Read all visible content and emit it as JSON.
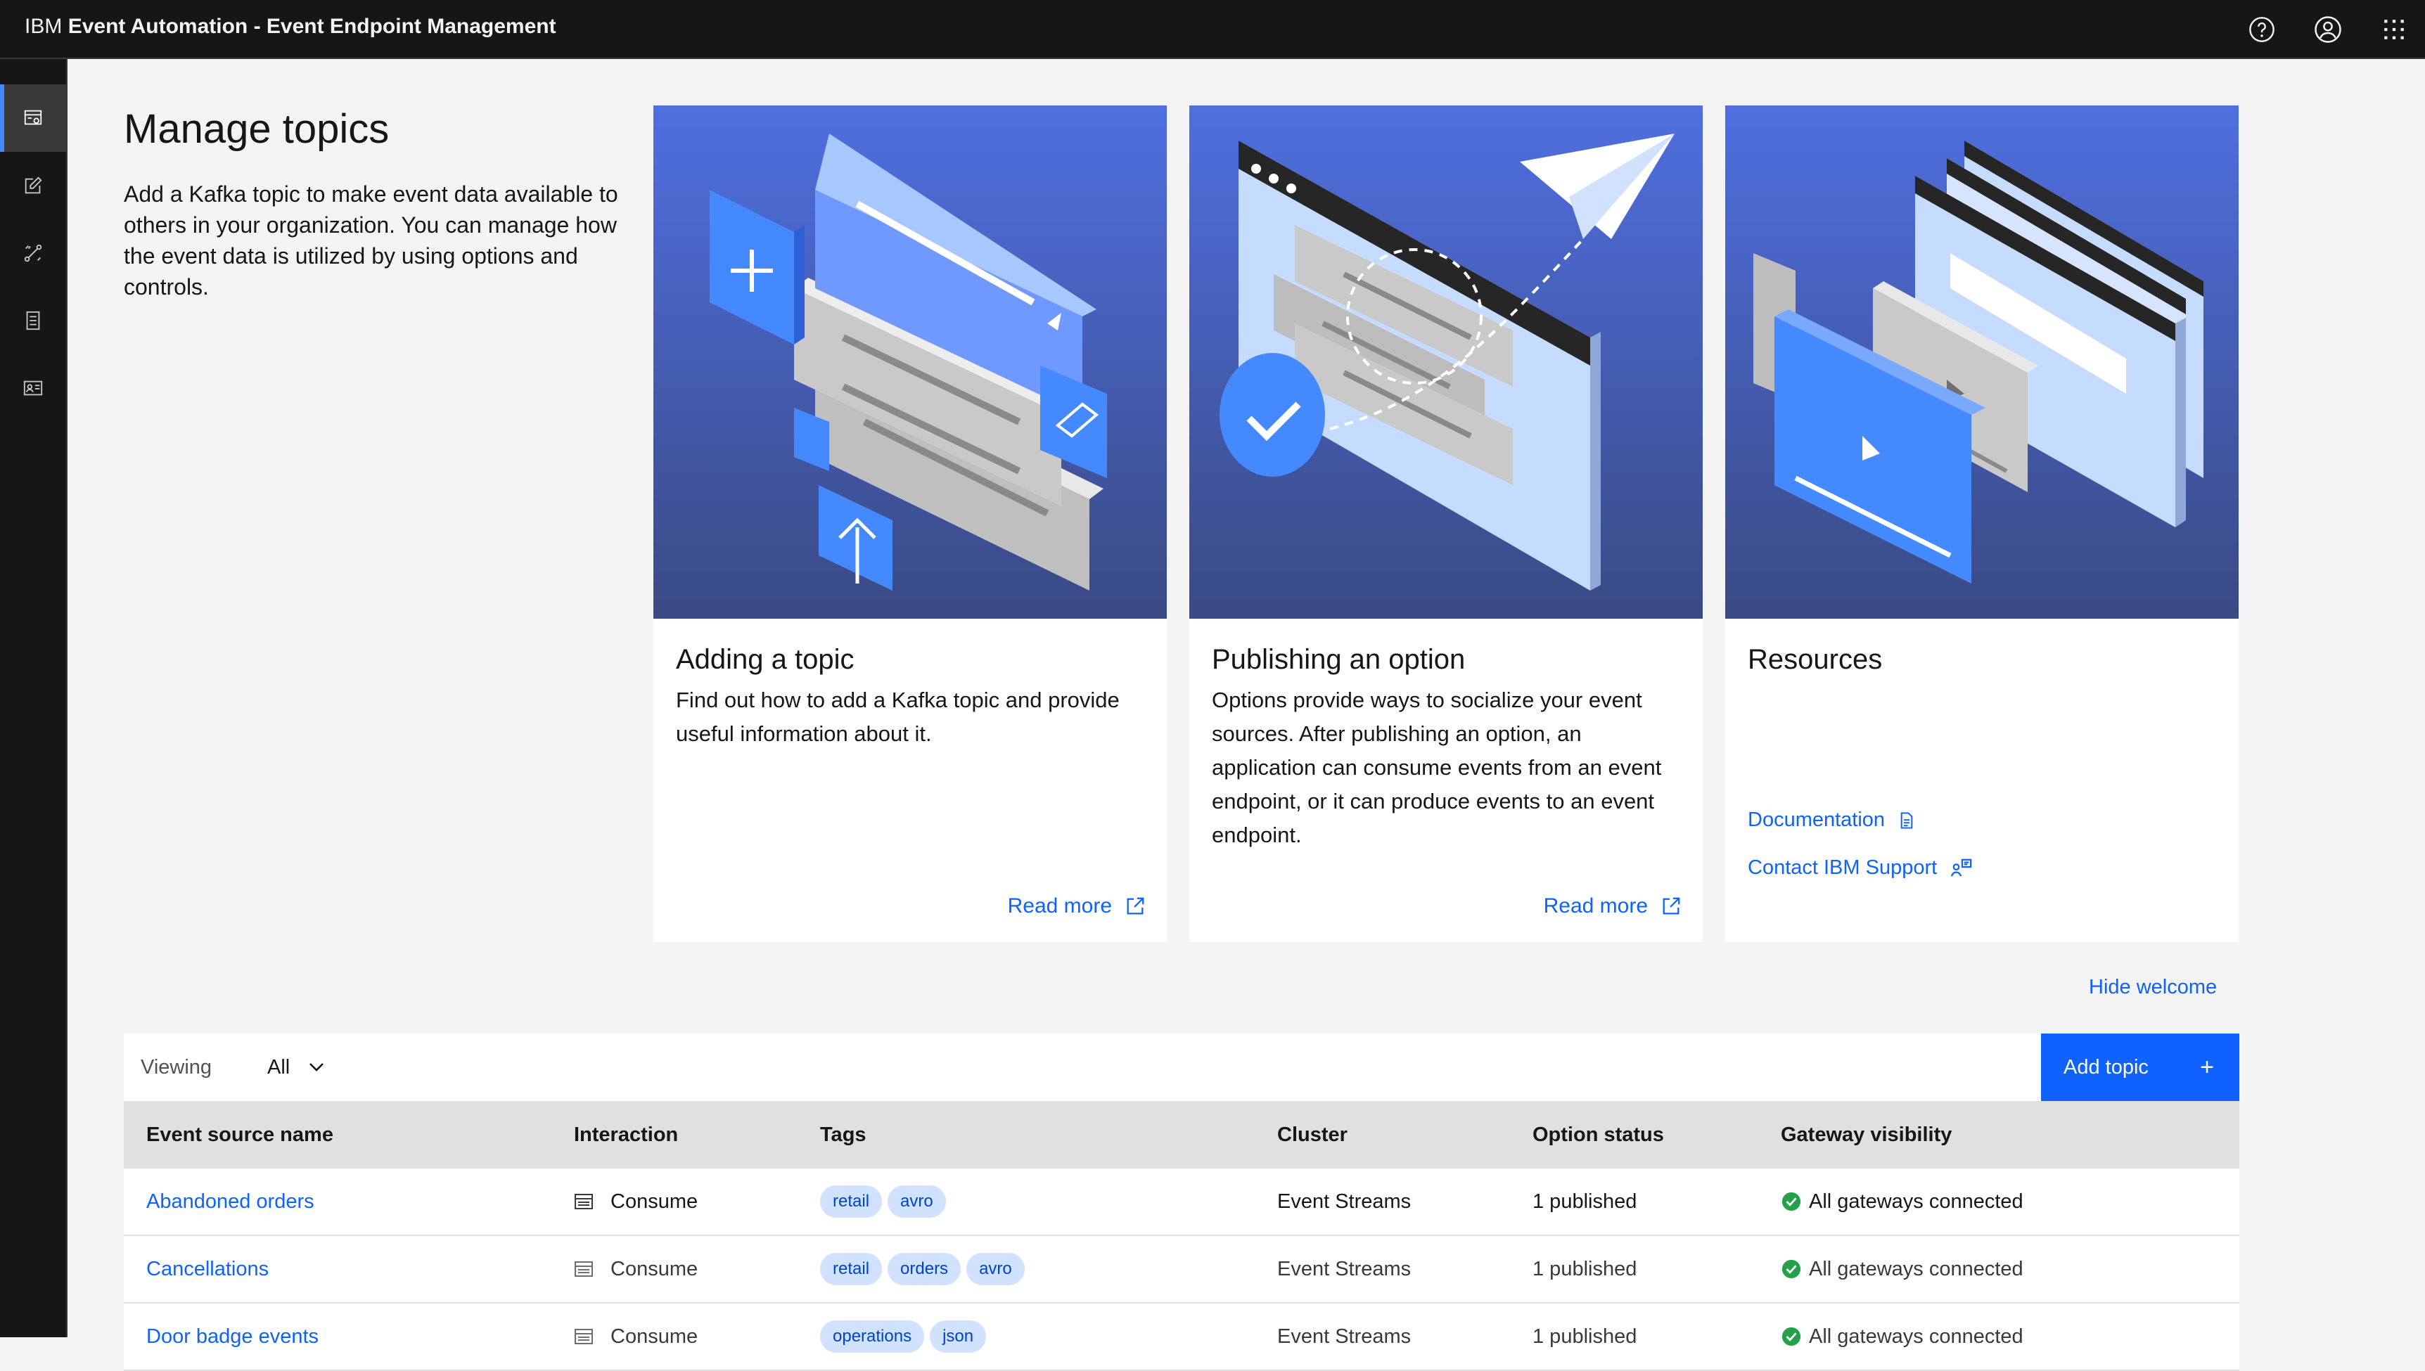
{
  "header": {
    "brand_prefix": "IBM",
    "brand_name": "Event Automation - Event Endpoint Management",
    "icons": [
      "help-icon",
      "user-avatar-icon",
      "app-switcher-icon"
    ]
  },
  "sidenav": {
    "items": [
      {
        "name": "topics",
        "icon": "catalog-icon",
        "active": true
      },
      {
        "name": "edit",
        "icon": "edit-icon",
        "active": false
      },
      {
        "name": "gateways",
        "icon": "connect-icon",
        "active": false
      },
      {
        "name": "documents",
        "icon": "document-icon",
        "active": false
      },
      {
        "name": "profile",
        "icon": "identification-icon",
        "active": false
      }
    ]
  },
  "intro": {
    "title": "Manage topics",
    "text": "Add a Kafka topic to make event data available to others in your organization. You can manage how the event data is utilized by using options and controls."
  },
  "cards": {
    "adding": {
      "title": "Adding a topic",
      "desc": "Find out how to add a Kafka topic and provide useful information about it.",
      "link": "Read more"
    },
    "publishing": {
      "title": "Publishing an option",
      "desc": "Options provide ways to socialize your event sources. After publishing an option, an application can consume events from an event endpoint, or it can produce events to an event endpoint.",
      "link": "Read more"
    },
    "resources": {
      "title": "Resources",
      "doc_link": "Documentation",
      "support_link": "Contact IBM Support"
    }
  },
  "hide_welcome": "Hide welcome",
  "toolbar": {
    "viewing_label": "Viewing",
    "viewing_value": "All",
    "add_button": "Add topic"
  },
  "table": {
    "headers": [
      "Event source name",
      "Interaction",
      "Tags",
      "Cluster",
      "Option status",
      "Gateway visibility"
    ],
    "rows": [
      {
        "name": "Abandoned orders",
        "interaction": "Consume",
        "tags": [
          "retail",
          "avro"
        ],
        "cluster": "Event Streams",
        "status": "1 published",
        "visibility": "All gateways connected"
      },
      {
        "name": "Cancellations",
        "interaction": "Consume",
        "tags": [
          "retail",
          "orders",
          "avro"
        ],
        "cluster": "Event Streams",
        "status": "1 published",
        "visibility": "All gateways connected"
      },
      {
        "name": "Door badge events",
        "interaction": "Consume",
        "tags": [
          "operations",
          "json"
        ],
        "cluster": "Event Streams",
        "status": "1 published",
        "visibility": "All gateways connected"
      }
    ]
  },
  "colors": {
    "primary": "#0f62fe",
    "header_bg": "#161616",
    "success": "#24a148",
    "tag_bg": "#d0e2ff"
  }
}
